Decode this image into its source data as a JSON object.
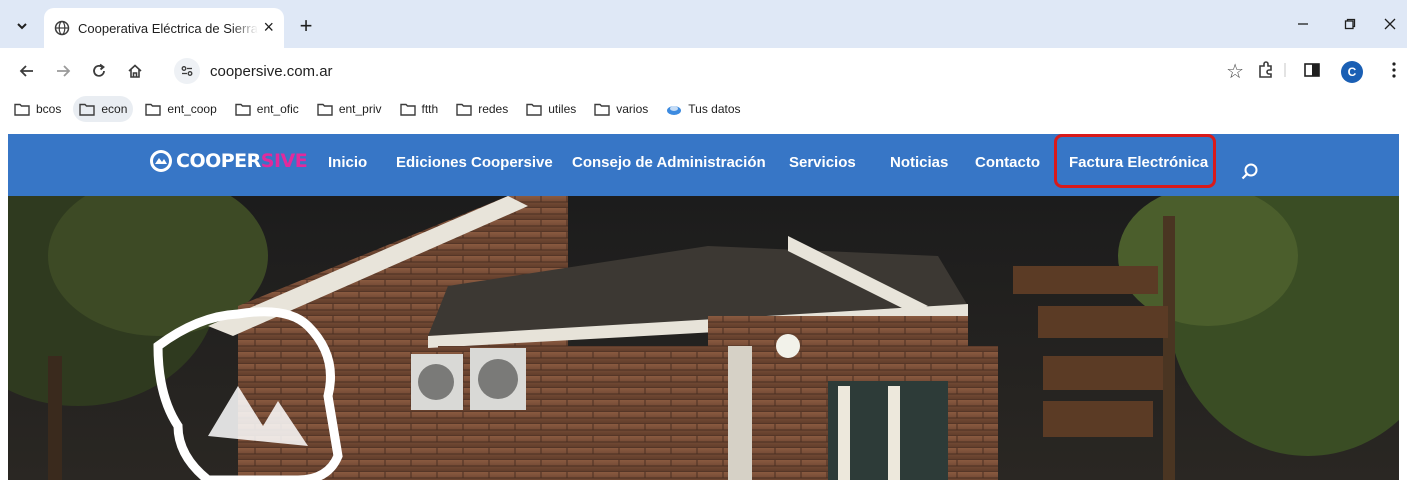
{
  "browser": {
    "tab": {
      "title": "Cooperativa Eléctrica de Sierra de la Ventana"
    },
    "address": {
      "url": "coopersive.com.ar"
    },
    "profile_initial": "C",
    "bookmarks": [
      {
        "label": "bcos",
        "active": false
      },
      {
        "label": "econ",
        "active": true
      },
      {
        "label": "ent_coop",
        "active": false
      },
      {
        "label": "ent_ofic",
        "active": false
      },
      {
        "label": "ent_priv",
        "active": false
      },
      {
        "label": "ftth",
        "active": false
      },
      {
        "label": "redes",
        "active": false
      },
      {
        "label": "utiles",
        "active": false
      },
      {
        "label": "varios",
        "active": false
      },
      {
        "label": "Tus datos",
        "active": false
      }
    ]
  },
  "site": {
    "logo": {
      "part1": "COOPER",
      "part2": "SIVE"
    },
    "nav": [
      {
        "label": "Inicio"
      },
      {
        "label": "Ediciones Coopersive"
      },
      {
        "label": "Consejo de Administración"
      },
      {
        "label": "Servicios"
      },
      {
        "label": "Noticias"
      },
      {
        "label": "Contacto"
      },
      {
        "label": "Factura Electrónica"
      }
    ],
    "highlight_color": "#d91a1a",
    "header_color": "#3776c6"
  }
}
